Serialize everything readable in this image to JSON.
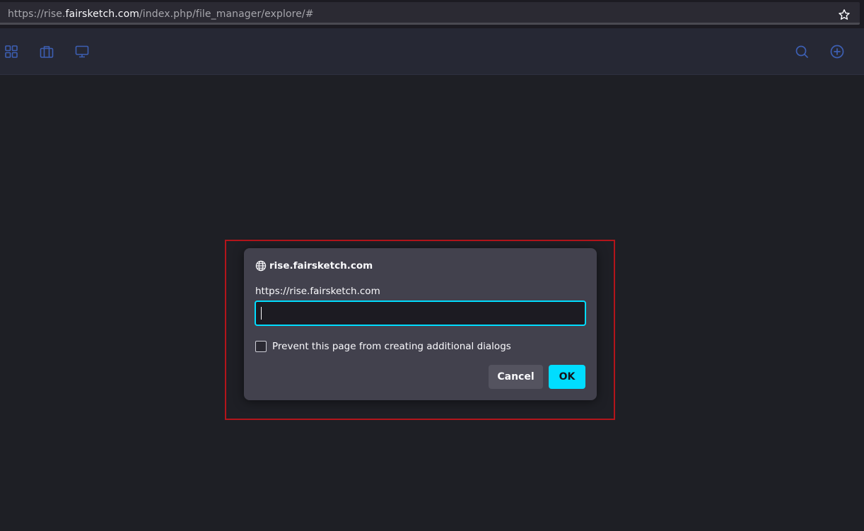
{
  "browser": {
    "url_prefix": "https://rise.",
    "url_host": "fairsketch.com",
    "url_path": "/index.php/file_manager/explore/#",
    "bookmark_icon": "star-icon"
  },
  "toolbar": {
    "icons_left": [
      "grid-icon",
      "briefcase-icon",
      "monitor-icon"
    ],
    "icons_right": [
      "search-icon",
      "add-circle-icon"
    ],
    "icon_color": "#3d5fb3"
  },
  "dialog": {
    "title": "rise.fairsketch.com",
    "title_icon": "globe-icon",
    "message": "https://rise.fairsketch.com",
    "input_value": "",
    "checkbox_label": "Prevent this page from creating additional dialogs",
    "checkbox_checked": false,
    "cancel_label": "Cancel",
    "ok_label": "OK",
    "accent_color": "#00ddff",
    "highlight_color": "#b3151b"
  }
}
